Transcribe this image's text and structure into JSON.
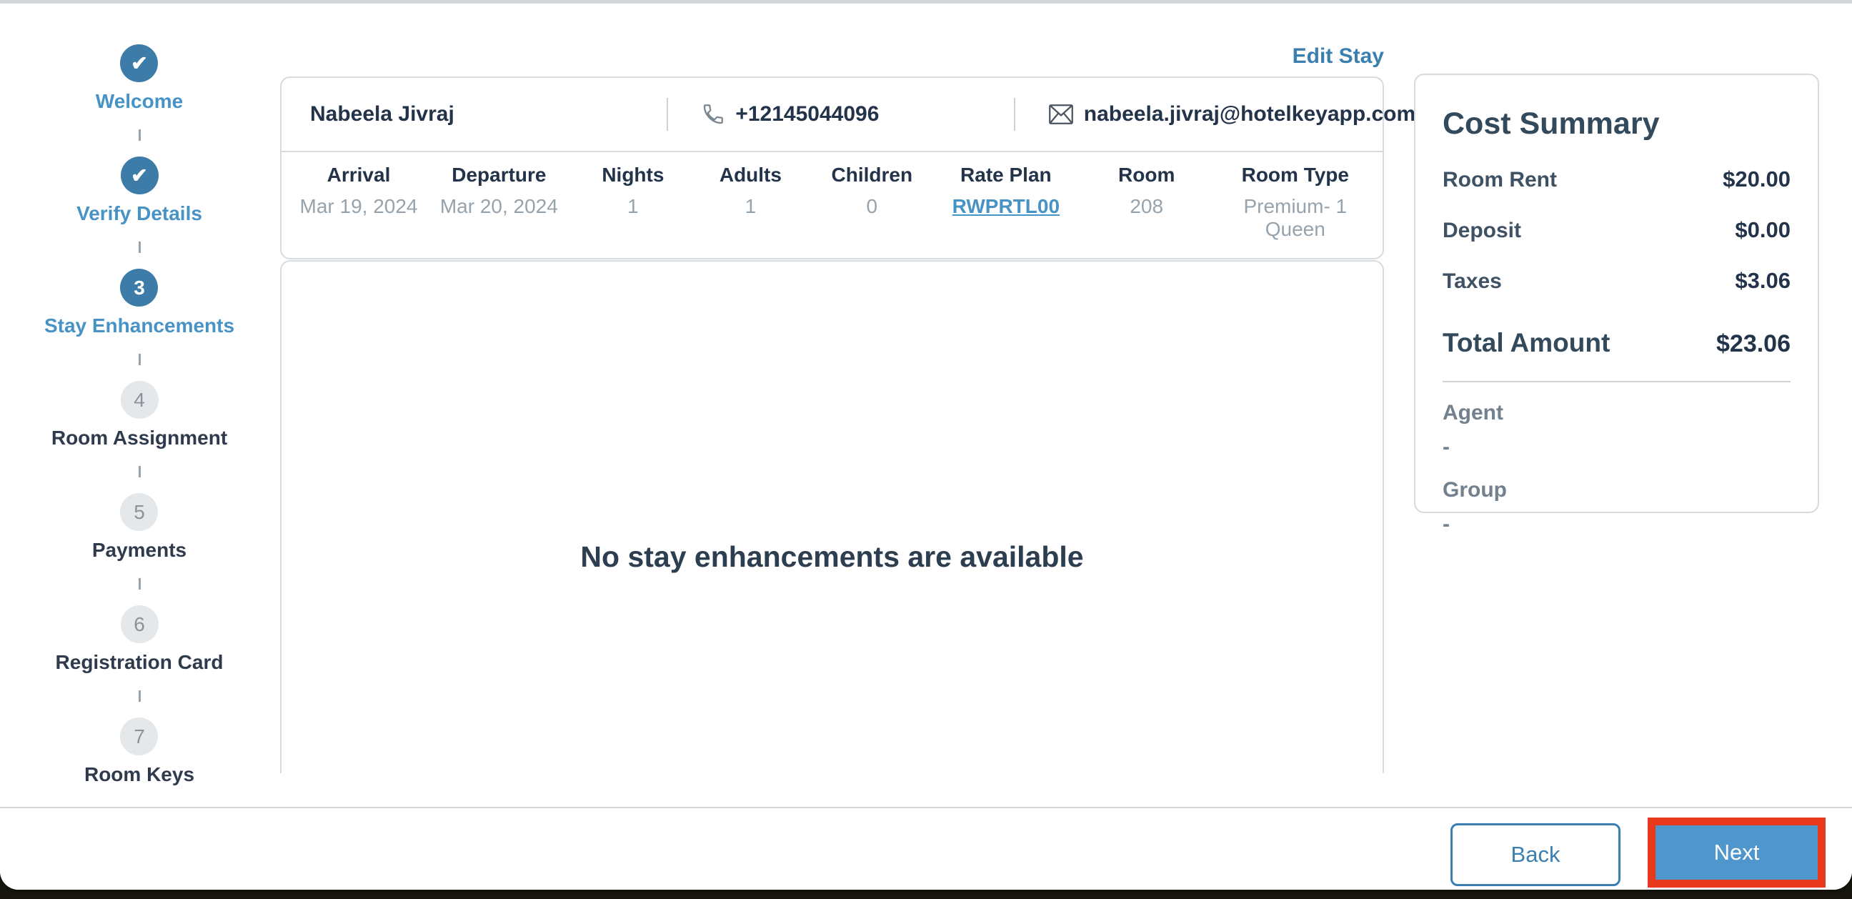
{
  "window": {
    "edit_stay_label": "Edit Stay",
    "empty_state_message": "No stay enhancements are available"
  },
  "stepper": {
    "steps": [
      {
        "glyph": "✔",
        "label": "Welcome",
        "state": "completed"
      },
      {
        "glyph": "✔",
        "label": "Verify Details",
        "state": "completed"
      },
      {
        "glyph": "3",
        "label": "Stay Enhancements",
        "state": "active"
      },
      {
        "glyph": "4",
        "label": "Room Assignment",
        "state": "upcoming"
      },
      {
        "glyph": "5",
        "label": "Payments",
        "state": "upcoming"
      },
      {
        "glyph": "6",
        "label": "Registration Card",
        "state": "upcoming"
      },
      {
        "glyph": "7",
        "label": "Room Keys",
        "state": "upcoming"
      }
    ]
  },
  "guest": {
    "name": "Nabeela Jivraj",
    "phone": "+12145044096",
    "email": "nabeela.jivraj@hotelkeyapp.com"
  },
  "stay_details": {
    "columns": [
      {
        "header": "Arrival",
        "value": "Mar 19, 2024"
      },
      {
        "header": "Departure",
        "value": "Mar 20, 2024"
      },
      {
        "header": "Nights",
        "value": "1"
      },
      {
        "header": "Adults",
        "value": "1"
      },
      {
        "header": "Children",
        "value": "0"
      },
      {
        "header": "Rate Plan",
        "value": "RWPRTL00",
        "link": true
      },
      {
        "header": "Room",
        "value": "208"
      },
      {
        "header": "Room Type",
        "value": "Premium- 1 Queen"
      }
    ]
  },
  "cost_summary": {
    "title": "Cost Summary",
    "rows": [
      {
        "label": "Room Rent",
        "value": "$20.00"
      },
      {
        "label": "Deposit",
        "value": "$0.00"
      },
      {
        "label": "Taxes",
        "value": "$3.06"
      }
    ],
    "total": {
      "label": "Total Amount",
      "value": "$23.06"
    },
    "extras": [
      {
        "label": "Agent",
        "value": "-"
      },
      {
        "label": "Group",
        "value": "-"
      }
    ]
  },
  "footer": {
    "back_label": "Back",
    "next_label": "Next"
  },
  "icons": {
    "check": "check-icon",
    "phone": "phone-icon",
    "email": "email-icon"
  },
  "colors": {
    "step_circle_blue": "#3d7ca8",
    "step_label_blue": "#4793c6",
    "link_blue": "#3a7fb0",
    "next_button_blue": "#4e96cb",
    "highlight_red": "#e8391d",
    "inactive_circle_gray": "#e4e8eb",
    "dark_text": "#22334a",
    "muted_text": "#97a3ac",
    "border_gray": "#d6dbde"
  }
}
